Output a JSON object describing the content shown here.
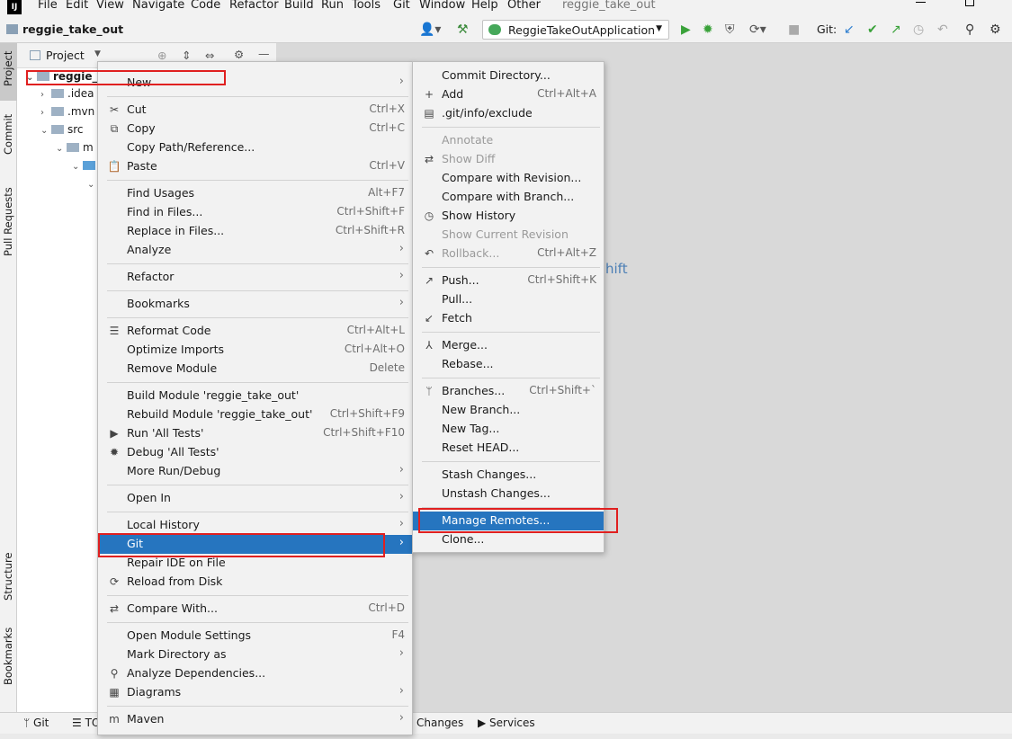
{
  "menubar": {
    "logo": "IJ",
    "items": [
      "File",
      "Edit",
      "View",
      "Navigate",
      "Code",
      "Refactor",
      "Build",
      "Run",
      "Tools",
      "Git",
      "Window",
      "Help",
      "Other"
    ],
    "window_title": "reggie_take_out"
  },
  "toolbar": {
    "project_name": "reggie_take_out",
    "run_config": "ReggieTakeOutApplication",
    "git_label": "Git:"
  },
  "left_tabs": [
    "Project",
    "Commit",
    "Pull Requests",
    "Structure",
    "Bookmarks"
  ],
  "project_panel": {
    "title": "Project",
    "tree": [
      {
        "text": "reggie_t",
        "bold": true
      },
      {
        "text": ".idea"
      },
      {
        "text": ".mvn"
      },
      {
        "text": "src"
      },
      {
        "text": "m"
      },
      {
        "text": ""
      },
      {
        "text": ""
      }
    ]
  },
  "editor": {
    "hint_fragment": "hift"
  },
  "bottom_bar": {
    "git": "Git",
    "todo": "TO",
    "changes": "Changes",
    "services": "Services"
  },
  "context_menu": {
    "items": [
      {
        "label": "New",
        "shortcut": "",
        "submenu": true,
        "icon": ""
      },
      {
        "sep": true
      },
      {
        "label": "Cut",
        "shortcut": "Ctrl+X",
        "icon": "✂"
      },
      {
        "label": "Copy",
        "shortcut": "Ctrl+C",
        "icon": "⧉"
      },
      {
        "label": "Copy Path/Reference...",
        "shortcut": "",
        "icon": ""
      },
      {
        "label": "Paste",
        "shortcut": "Ctrl+V",
        "icon": "📋"
      },
      {
        "sep": true
      },
      {
        "label": "Find Usages",
        "shortcut": "Alt+F7",
        "icon": ""
      },
      {
        "label": "Find in Files...",
        "shortcut": "Ctrl+Shift+F",
        "icon": ""
      },
      {
        "label": "Replace in Files...",
        "shortcut": "Ctrl+Shift+R",
        "icon": ""
      },
      {
        "label": "Analyze",
        "shortcut": "",
        "submenu": true,
        "icon": ""
      },
      {
        "sep": true
      },
      {
        "label": "Refactor",
        "shortcut": "",
        "submenu": true,
        "icon": ""
      },
      {
        "sep": true
      },
      {
        "label": "Bookmarks",
        "shortcut": "",
        "submenu": true,
        "icon": ""
      },
      {
        "sep": true
      },
      {
        "label": "Reformat Code",
        "shortcut": "Ctrl+Alt+L",
        "icon": "☰"
      },
      {
        "label": "Optimize Imports",
        "shortcut": "Ctrl+Alt+O",
        "icon": ""
      },
      {
        "label": "Remove Module",
        "shortcut": "Delete",
        "icon": ""
      },
      {
        "sep": true
      },
      {
        "label": "Build Module 'reggie_take_out'",
        "shortcut": "",
        "icon": ""
      },
      {
        "label": "Rebuild Module 'reggie_take_out'",
        "shortcut": "Ctrl+Shift+F9",
        "icon": ""
      },
      {
        "label": "Run 'All Tests'",
        "shortcut": "Ctrl+Shift+F10",
        "icon": "▶"
      },
      {
        "label": "Debug 'All Tests'",
        "shortcut": "",
        "icon": "✹"
      },
      {
        "label": "More Run/Debug",
        "shortcut": "",
        "submenu": true,
        "icon": ""
      },
      {
        "sep": true
      },
      {
        "label": "Open In",
        "shortcut": "",
        "submenu": true,
        "icon": ""
      },
      {
        "sep": true
      },
      {
        "label": "Local History",
        "shortcut": "",
        "submenu": true,
        "icon": ""
      },
      {
        "label": "Git",
        "shortcut": "",
        "submenu": true,
        "icon": "",
        "selected": true
      },
      {
        "label": "Repair IDE on File",
        "shortcut": "",
        "icon": ""
      },
      {
        "label": "Reload from Disk",
        "shortcut": "",
        "icon": "⟳"
      },
      {
        "sep": true
      },
      {
        "label": "Compare With...",
        "shortcut": "Ctrl+D",
        "icon": "⇄"
      },
      {
        "sep": true
      },
      {
        "label": "Open Module Settings",
        "shortcut": "F4",
        "icon": ""
      },
      {
        "label": "Mark Directory as",
        "shortcut": "",
        "submenu": true,
        "icon": ""
      },
      {
        "label": "Analyze Dependencies...",
        "shortcut": "",
        "icon": "⚲"
      },
      {
        "label": "Diagrams",
        "shortcut": "",
        "submenu": true,
        "icon": "▦"
      },
      {
        "sep": true
      },
      {
        "label": "Maven",
        "shortcut": "",
        "submenu": true,
        "icon": "m"
      }
    ]
  },
  "git_menu": {
    "items": [
      {
        "label": "Commit Directory...",
        "shortcut": "",
        "icon": ""
      },
      {
        "label": "Add",
        "shortcut": "Ctrl+Alt+A",
        "icon": "+"
      },
      {
        "label": ".git/info/exclude",
        "shortcut": "",
        "icon": "▤"
      },
      {
        "sep": true
      },
      {
        "label": "Annotate",
        "shortcut": "",
        "icon": "",
        "disabled": true
      },
      {
        "label": "Show Diff",
        "shortcut": "",
        "icon": "⇄",
        "disabled": true
      },
      {
        "label": "Compare with Revision...",
        "shortcut": "",
        "icon": ""
      },
      {
        "label": "Compare with Branch...",
        "shortcut": "",
        "icon": ""
      },
      {
        "label": "Show History",
        "shortcut": "",
        "icon": "◷"
      },
      {
        "label": "Show Current Revision",
        "shortcut": "",
        "icon": "",
        "disabled": true
      },
      {
        "label": "Rollback...",
        "shortcut": "Ctrl+Alt+Z",
        "icon": "↶",
        "disabled": true
      },
      {
        "sep": true
      },
      {
        "label": "Push...",
        "shortcut": "Ctrl+Shift+K",
        "icon": "↗"
      },
      {
        "label": "Pull...",
        "shortcut": "",
        "icon": ""
      },
      {
        "label": "Fetch",
        "shortcut": "",
        "icon": "↙"
      },
      {
        "sep": true
      },
      {
        "label": "Merge...",
        "shortcut": "",
        "icon": "⅄"
      },
      {
        "label": "Rebase...",
        "shortcut": "",
        "icon": ""
      },
      {
        "sep": true
      },
      {
        "label": "Branches...",
        "shortcut": "Ctrl+Shift+`",
        "icon": "ᛘ"
      },
      {
        "label": "New Branch...",
        "shortcut": "",
        "icon": ""
      },
      {
        "label": "New Tag...",
        "shortcut": "",
        "icon": ""
      },
      {
        "label": "Reset HEAD...",
        "shortcut": "",
        "icon": ""
      },
      {
        "sep": true
      },
      {
        "label": "Stash Changes...",
        "shortcut": "",
        "icon": ""
      },
      {
        "label": "Unstash Changes...",
        "shortcut": "",
        "icon": ""
      },
      {
        "sep": true
      },
      {
        "label": "Manage Remotes...",
        "shortcut": "",
        "icon": "",
        "selected": true
      },
      {
        "label": "Clone...",
        "shortcut": "",
        "icon": ""
      }
    ]
  },
  "colors": {
    "selection": "#2675bf",
    "highlight_box": "#e02020",
    "menu_bg": "#f2f2f2"
  }
}
